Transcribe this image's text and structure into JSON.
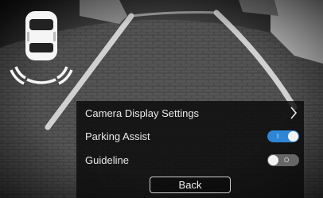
{
  "panel": {
    "title": "Camera Display Settings",
    "parking_assist": {
      "label": "Parking Assist",
      "state": "on",
      "mark": "I"
    },
    "guideline": {
      "label": "Guideline",
      "state": "off",
      "mark": "O"
    },
    "back_label": "Back"
  },
  "colors": {
    "toggle_on": "#2e86d6",
    "toggle_off": "#666666",
    "parking_lines": "#e8e8e8"
  },
  "icons": {
    "car": "car-top-view-icon",
    "sensors": "parking-sensor-arc-icon",
    "chevron": "chevron-right-icon"
  }
}
